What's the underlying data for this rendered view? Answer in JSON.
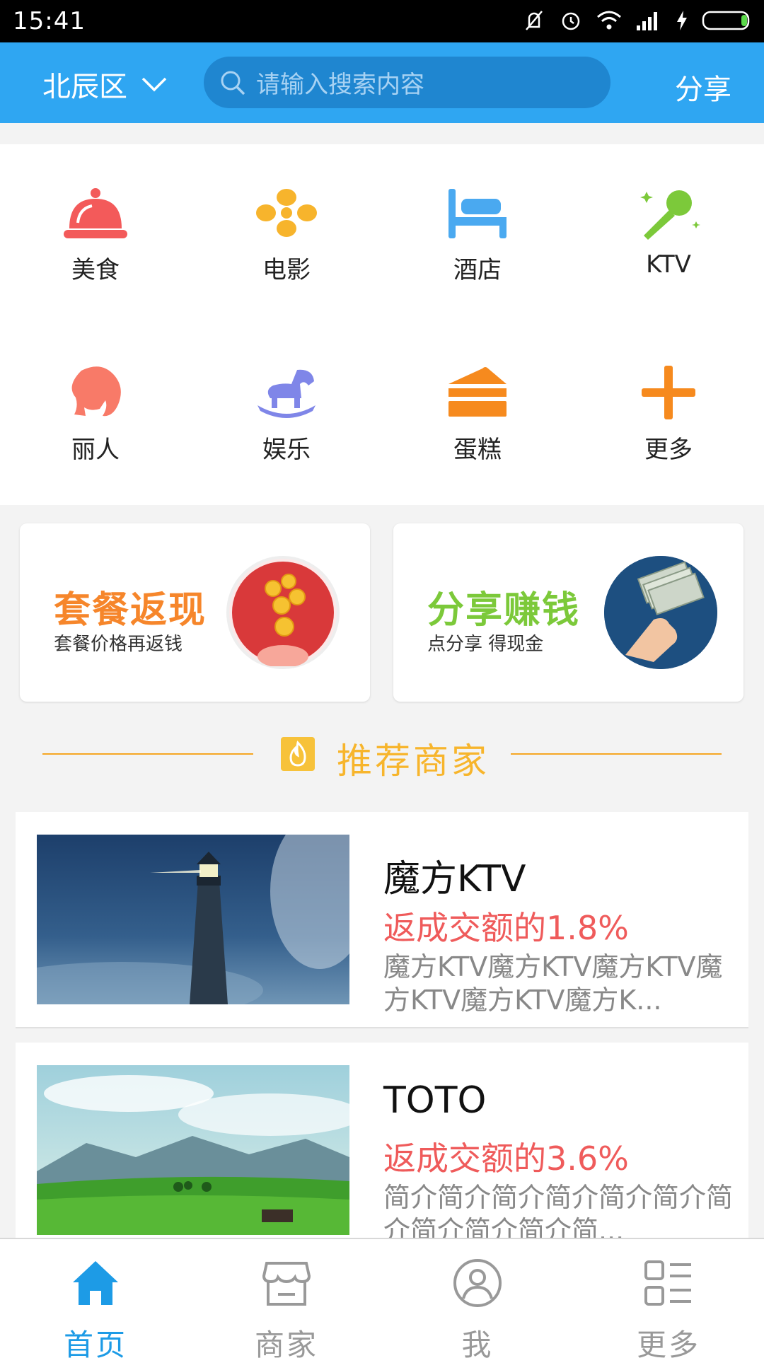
{
  "status_bar": {
    "time": "15:41"
  },
  "header": {
    "district": "北辰区",
    "search_placeholder": "请输入搜索内容",
    "share_label": "分享"
  },
  "categories": [
    {
      "label": "美食",
      "icon": "food-cloche-icon",
      "color": "#f35a5a"
    },
    {
      "label": "电影",
      "icon": "movie-flower-icon",
      "color": "#f7b42c"
    },
    {
      "label": "酒店",
      "icon": "hotel-bed-icon",
      "color": "#4aa9f0"
    },
    {
      "label": "KTV",
      "icon": "microphone-icon",
      "color": "#7cc93a"
    },
    {
      "label": "丽人",
      "icon": "beauty-woman-icon",
      "color": "#f87a68"
    },
    {
      "label": "娱乐",
      "icon": "rocking-horse-icon",
      "color": "#7f86e8"
    },
    {
      "label": "蛋糕",
      "icon": "cake-icon",
      "color": "#f68a1e"
    },
    {
      "label": "更多",
      "icon": "plus-icon",
      "color": "#f68a1e"
    }
  ],
  "promos": [
    {
      "title": "套餐返现",
      "subtitle": "套餐价格再返钱",
      "color": "#f6862b"
    },
    {
      "title": "分享赚钱",
      "subtitle": "点分享 得现金",
      "color": "#7cc93a"
    }
  ],
  "section_title": "推荐商家",
  "merchants": [
    {
      "name": "魔方KTV",
      "rebate": "返成交额的1.8%",
      "desc": "魔方KTV魔方KTV魔方KTV魔方KTV魔方KTV魔方K..."
    },
    {
      "name": "TOTO",
      "rebate": "返成交额的3.6%",
      "desc": "简介简介简介简介简介简介简介简介简介简介简..."
    }
  ],
  "bottom_nav": [
    {
      "label": "首页",
      "icon": "home-icon",
      "active": true
    },
    {
      "label": "商家",
      "icon": "shop-icon",
      "active": false
    },
    {
      "label": "我",
      "icon": "user-icon",
      "active": false
    },
    {
      "label": "更多",
      "icon": "list-icon",
      "active": false
    }
  ],
  "colors": {
    "primary": "#2fa6f2",
    "accent": "#f7b52c",
    "rebate": "#ef5b5b",
    "active_tab": "#1d9be6"
  }
}
